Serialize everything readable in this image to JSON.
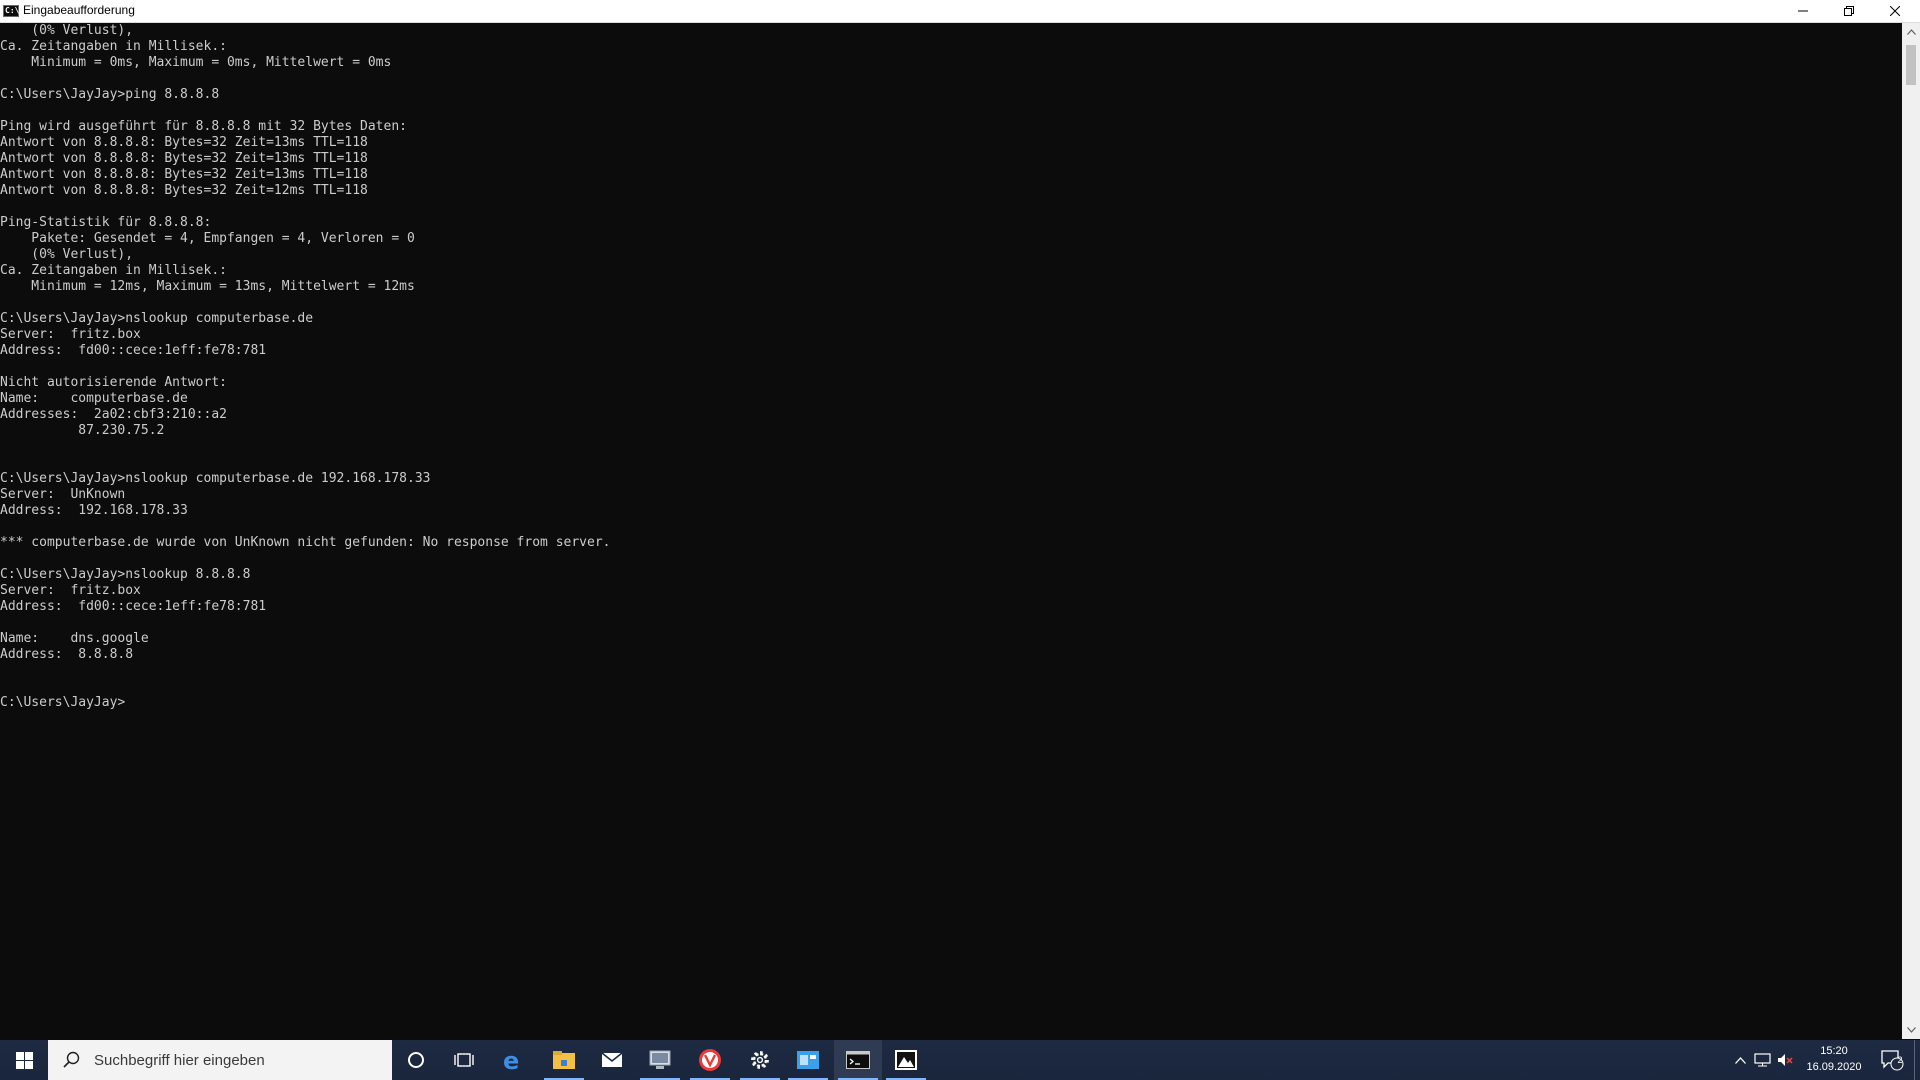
{
  "window": {
    "title": "Eingabeaufforderung",
    "icon_label": "C:\\",
    "controls": [
      "minimize-icon",
      "restore-icon",
      "close-icon"
    ]
  },
  "console_lines": [
    "    (0% Verlust),",
    "Ca. Zeitangaben in Millisek.:",
    "    Minimum = 0ms, Maximum = 0ms, Mittelwert = 0ms",
    "",
    "C:\\Users\\JayJay>ping 8.8.8.8",
    "",
    "Ping wird ausgeführt für 8.8.8.8 mit 32 Bytes Daten:",
    "Antwort von 8.8.8.8: Bytes=32 Zeit=13ms TTL=118",
    "Antwort von 8.8.8.8: Bytes=32 Zeit=13ms TTL=118",
    "Antwort von 8.8.8.8: Bytes=32 Zeit=13ms TTL=118",
    "Antwort von 8.8.8.8: Bytes=32 Zeit=12ms TTL=118",
    "",
    "Ping-Statistik für 8.8.8.8:",
    "    Pakete: Gesendet = 4, Empfangen = 4, Verloren = 0",
    "    (0% Verlust),",
    "Ca. Zeitangaben in Millisek.:",
    "    Minimum = 12ms, Maximum = 13ms, Mittelwert = 12ms",
    "",
    "C:\\Users\\JayJay>nslookup computerbase.de",
    "Server:  fritz.box",
    "Address:  fd00::cece:1eff:fe78:781",
    "",
    "Nicht autorisierende Antwort:",
    "Name:    computerbase.de",
    "Addresses:  2a02:cbf3:210::a2",
    "          87.230.75.2",
    "",
    "",
    "C:\\Users\\JayJay>nslookup computerbase.de 192.168.178.33",
    "Server:  UnKnown",
    "Address:  192.168.178.33",
    "",
    "*** computerbase.de wurde von UnKnown nicht gefunden: No response from server.",
    "",
    "C:\\Users\\JayJay>nslookup 8.8.8.8",
    "Server:  fritz.box",
    "Address:  fd00::cece:1eff:fe78:781",
    "",
    "Name:    dns.google",
    "Address:  8.8.8.8",
    "",
    "",
    "C:\\Users\\JayJay>"
  ],
  "taskbar": {
    "search_placeholder": "Suchbegriff hier eingeben",
    "apps": [
      {
        "name": "cortana-icon",
        "active": false
      },
      {
        "name": "task-view-icon",
        "active": false
      },
      {
        "name": "edge-icon",
        "active": false
      },
      {
        "name": "file-explorer-icon",
        "active": true
      },
      {
        "name": "mail-icon",
        "active": false
      },
      {
        "name": "network-app-icon",
        "active": true
      },
      {
        "name": "vivaldi-icon",
        "active": true
      },
      {
        "name": "settings-icon",
        "active": true
      },
      {
        "name": "control-panel-icon",
        "active": true
      },
      {
        "name": "command-prompt-icon",
        "active": true
      },
      {
        "name": "photos-icon",
        "active": true
      }
    ],
    "clock": {
      "time": "15:20",
      "date": "16.09.2020"
    },
    "notification_count": "2",
    "accent_color": "#7fb8ff"
  },
  "colors": {
    "console_bg": "#0c0c0c",
    "console_fg": "#cccccc"
  }
}
